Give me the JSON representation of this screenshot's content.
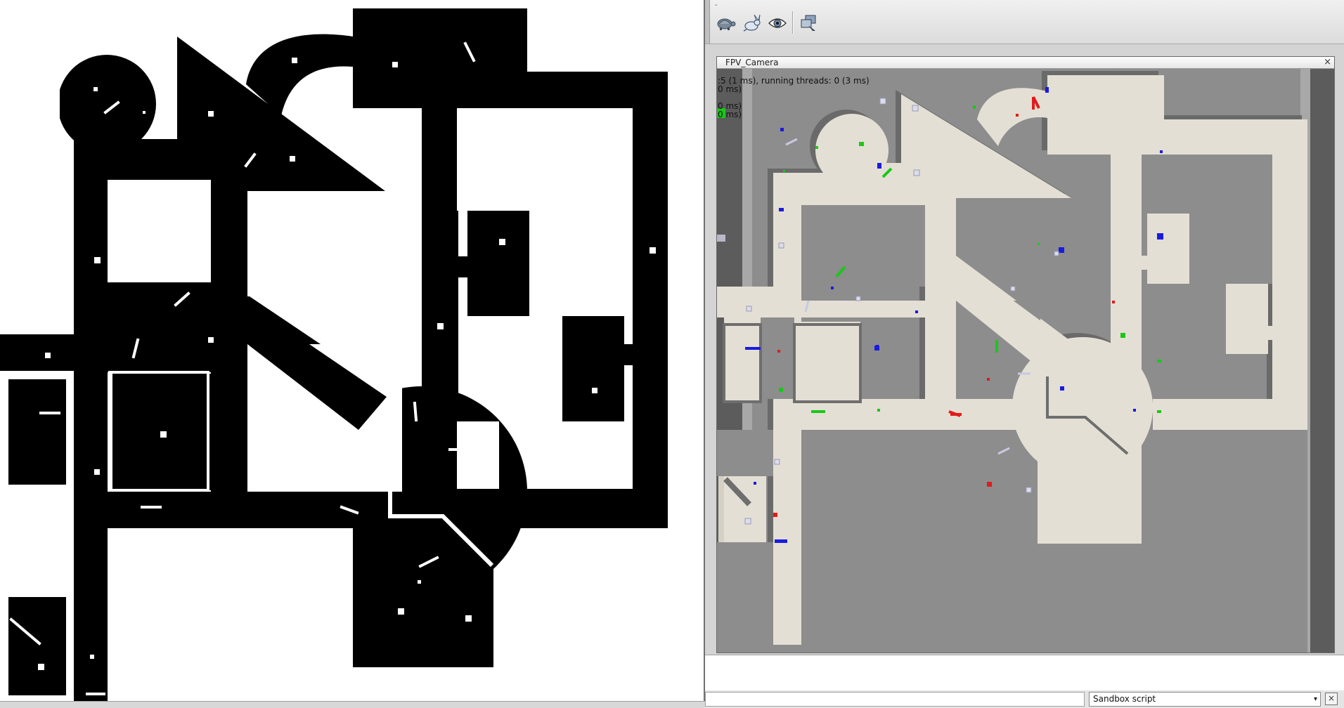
{
  "toolbar": {
    "icons": [
      "turtle-icon",
      "rabbit-icon",
      "eye-icon",
      "camera-view-icon"
    ],
    "caret": "-"
  },
  "viewport": {
    "title": "FPV_Camera",
    "close_symbol": "×",
    "overlay_lines": [
      ":5 (1 ms), running threads: 0 (3 ms)",
      "0 ms)",
      "0 ms)",
      "0 ms)"
    ]
  },
  "statusbar": {
    "script_selector": "Sandbox script",
    "select_arrow": "▾",
    "clear_symbol": "×"
  },
  "colors": {
    "floor": "#e4dfd4",
    "wall_shadow": "#6e6e6e",
    "background_gray": "#8d8d8d",
    "object_red": "#e11b1b",
    "object_green": "#18c818",
    "object_blue": "#1a1ae0"
  }
}
